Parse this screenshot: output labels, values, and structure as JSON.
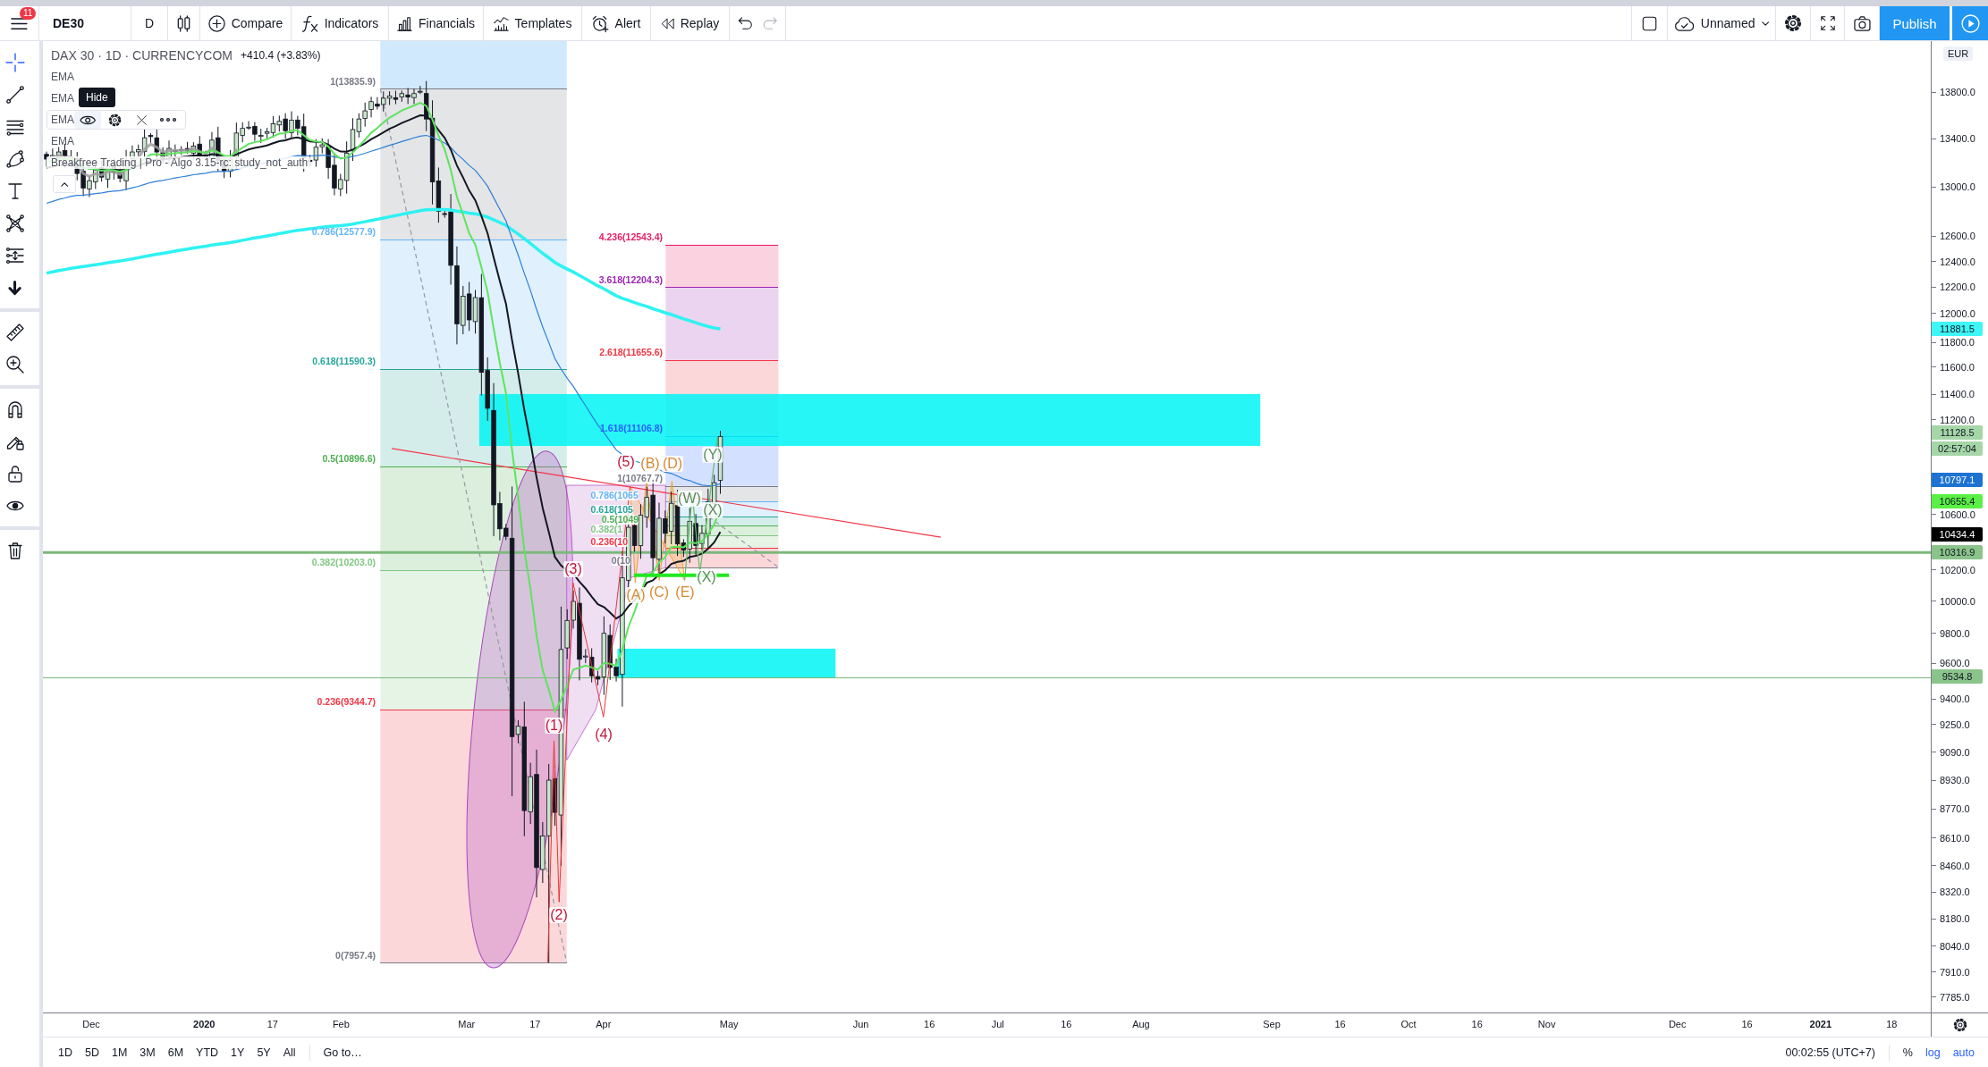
{
  "top_toolbar": {
    "notification_count": "11",
    "symbol": "DE30",
    "interval": "D",
    "buttons": [
      {
        "kind": "compare",
        "label": "Compare"
      },
      {
        "kind": "indicators",
        "label": "Indicators"
      },
      {
        "kind": "financials",
        "label": "Financials"
      },
      {
        "kind": "templates",
        "label": "Templates"
      },
      {
        "kind": "alert",
        "label": "Alert"
      },
      {
        "kind": "replay",
        "label": "Replay"
      }
    ],
    "undo": {
      "disabled": false
    },
    "redo": {
      "disabled": true
    },
    "layout_name": "Unnamed",
    "publish_label": "Publish"
  },
  "drawing_tools": {
    "groups": [
      {
        "tools": [
          {
            "kind": "crosshair",
            "selected": true
          },
          {
            "kind": "trend-line",
            "selected": false
          },
          {
            "kind": "fib",
            "selected": false
          },
          {
            "kind": "brush",
            "selected": false
          },
          {
            "kind": "text",
            "selected": false
          },
          {
            "kind": "pattern",
            "selected": false
          },
          {
            "kind": "prediction",
            "selected": false
          },
          {
            "kind": "arrow",
            "selected": false
          }
        ]
      },
      {
        "tools": [
          {
            "kind": "ruler",
            "selected": false
          },
          {
            "kind": "zoom",
            "selected": false
          }
        ]
      },
      {
        "tools": [
          {
            "kind": "magnet",
            "selected": false
          },
          {
            "kind": "stay-in-drawing",
            "selected": false
          },
          {
            "kind": "lock",
            "selected": false
          },
          {
            "kind": "hide",
            "selected": false
          }
        ]
      },
      {
        "tools": [
          {
            "kind": "trash",
            "selected": false
          }
        ]
      }
    ]
  },
  "legend": {
    "title": "DAX 30 · 1D · CURRENCYCOM",
    "change": "+410.4 (+3.83%)",
    "indicators": [
      {
        "name": "EMA",
        "hovered": false
      },
      {
        "name": "EMA",
        "hovered": false
      },
      {
        "name": "EMA",
        "hovered": true
      },
      {
        "name": "EMA",
        "hovered": false
      }
    ],
    "tooltip": "Hide",
    "script": "Breakfree Trading | Pro - Algo 3.15-rc: study_not_auth"
  },
  "chart": {
    "fib_retracement": {
      "levels": [
        {
          "label": "1(13835.9)",
          "color": "#787b86"
        },
        {
          "label": "0.786(12577.9)",
          "color": "#64b5f6"
        },
        {
          "label": "0.618(11590.3)",
          "color": "#26a69a"
        },
        {
          "label": "0.5(10896.6)",
          "color": "#4caf50"
        },
        {
          "label": "0.382(10203.0)",
          "color": "#81c784"
        },
        {
          "label": "0.236(9344.7)",
          "color": "#f23645"
        },
        {
          "label": "0(7957.4)",
          "color": "#787b86"
        }
      ]
    },
    "fib_extension": {
      "levels": [
        {
          "label": "4.236(12543.4)",
          "color": "#e91e63"
        },
        {
          "label": "3.618(12204.3)",
          "color": "#9c27b0"
        },
        {
          "label": "2.618(11655.6)",
          "color": "#f23645"
        },
        {
          "label": "1.618(11106.8)",
          "color": "#2962ff"
        },
        {
          "label": "1(10767.7)",
          "color": "#787b86"
        },
        {
          "label": "0.786(1065",
          "color": "#64b5f6"
        },
        {
          "label": "0.618(105",
          "color": "#26a69a"
        },
        {
          "label": "0.5(1049",
          "color": "#4caf50"
        },
        {
          "label": "0.382(1",
          "color": "#81c784"
        },
        {
          "label": "0.236(10",
          "color": "#f23645"
        },
        {
          "label": "0(10",
          "color": "#787b86"
        }
      ]
    },
    "wave_labels": [
      {
        "text": "(1)",
        "color": "#c0163c"
      },
      {
        "text": "(2)",
        "color": "#c0163c"
      },
      {
        "text": "(3)",
        "color": "#c0163c"
      },
      {
        "text": "(4)",
        "color": "#c0163c"
      },
      {
        "text": "(5)",
        "color": "#c0163c"
      },
      {
        "text": "(A)",
        "color": "#d68a35"
      },
      {
        "text": "(B)",
        "color": "#d68a35"
      },
      {
        "text": "(C)",
        "color": "#d68a35"
      },
      {
        "text": "(D)",
        "color": "#d68a35"
      },
      {
        "text": "(E)",
        "color": "#d68a35"
      },
      {
        "text": "(W)",
        "color": "#5a8c5a"
      },
      {
        "text": "(Y)",
        "color": "#5a8c5a"
      },
      {
        "text": "(X)",
        "color": "#5a8c5a"
      },
      {
        "text": "(X)",
        "color": "#5a8c5a"
      }
    ]
  },
  "price_axis": {
    "currency": "EUR",
    "ticks": [
      "13800.0",
      "13400.0",
      "13000.0",
      "12600.0",
      "12400.0",
      "12200.0",
      "12000.0",
      "11800.0",
      "11600.0",
      "11400.0",
      "11200.0",
      "10600.0",
      "10200.0",
      "10000.0",
      "9800.0",
      "9600.0",
      "9400.0",
      "9250.0",
      "9090.0",
      "8930.0",
      "8770.0",
      "8610.0",
      "8460.0",
      "8320.0",
      "8180.0",
      "8040.0",
      "7910.0",
      "7785.0"
    ],
    "tags": [
      {
        "text": "11881.5",
        "color": "#3ff6f6"
      },
      {
        "text": "11128.5",
        "color": "#a5d6a7"
      },
      {
        "text": "02:57:04",
        "color": "#a5d6a7"
      },
      {
        "text": "10797.1",
        "color": "#1e73d2"
      },
      {
        "text": "10655.4",
        "color": "#5af046"
      },
      {
        "text": "10434.4",
        "color": "#000000"
      },
      {
        "text": "10316.9",
        "color": "#8bc48a"
      },
      {
        "text": "9534.8",
        "color": "#8bc48a"
      }
    ]
  },
  "time_axis": {
    "labels": [
      {
        "text": "Dec",
        "kind": "month"
      },
      {
        "text": "2020",
        "kind": "year"
      },
      {
        "text": "17",
        "kind": "day"
      },
      {
        "text": "Feb",
        "kind": "month"
      },
      {
        "text": "Mar",
        "kind": "month"
      },
      {
        "text": "17",
        "kind": "day"
      },
      {
        "text": "Apr",
        "kind": "month"
      },
      {
        "text": "May",
        "kind": "month"
      },
      {
        "text": "Jun",
        "kind": "month"
      },
      {
        "text": "16",
        "kind": "day"
      },
      {
        "text": "Jul",
        "kind": "month"
      },
      {
        "text": "16",
        "kind": "day"
      },
      {
        "text": "Aug",
        "kind": "month"
      },
      {
        "text": "Sep",
        "kind": "month"
      },
      {
        "text": "16",
        "kind": "day"
      },
      {
        "text": "Oct",
        "kind": "month"
      },
      {
        "text": "16",
        "kind": "day"
      },
      {
        "text": "Nov",
        "kind": "month"
      },
      {
        "text": "Dec",
        "kind": "month"
      },
      {
        "text": "16",
        "kind": "day"
      },
      {
        "text": "2021",
        "kind": "year"
      },
      {
        "text": "18",
        "kind": "day"
      }
    ]
  },
  "bottom_bar": {
    "ranges": [
      "1D",
      "5D",
      "1M",
      "3M",
      "6M",
      "YTD",
      "1Y",
      "5Y",
      "All"
    ],
    "goto": "Go to…",
    "clock": "00:02:55 (UTC+7)",
    "scale_toggles": [
      {
        "label": "%",
        "on": false
      },
      {
        "label": "log",
        "on": true
      },
      {
        "label": "auto",
        "on": true
      }
    ]
  }
}
